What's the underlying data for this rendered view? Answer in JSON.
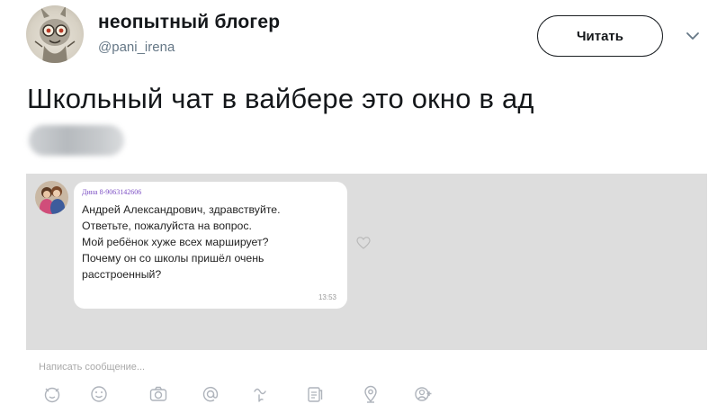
{
  "tweet": {
    "author_name": "неопытный блогер",
    "author_handle": "@pani_irena",
    "follow_label": "Читать",
    "text": "Школьный чат в вайбере это окно в ад"
  },
  "viber": {
    "sender": "Дина 8-9063142606",
    "message": "Андрей Александрович, здравствуйте.\nОтветьте, пожалуйста на вопрос.\nМой ребёнок хуже всех марширует?\nПочему он со школы пришёл очень\nрасстроенный?",
    "time": "13:53",
    "input_placeholder": "Написать сообщение...",
    "toolbar_icons": [
      "sticker-icon",
      "emoji-icon",
      "camera-icon",
      "mention-icon",
      "doodle-icon",
      "gif-icon",
      "location-icon",
      "add-contact-icon"
    ]
  },
  "colors": {
    "sender_name": "#7c4fc4",
    "chat_background": "#dddddd",
    "secondary_text": "#657786"
  }
}
